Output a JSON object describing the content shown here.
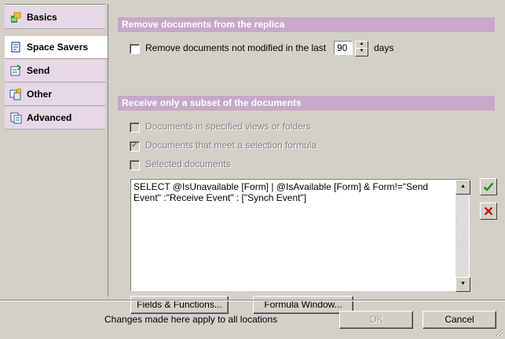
{
  "sidebar": {
    "items": [
      {
        "label": "Basics",
        "icon": "basics-icon"
      },
      {
        "label": "Space Savers",
        "icon": "space-savers-icon",
        "active": true
      },
      {
        "label": "Send",
        "icon": "send-icon"
      },
      {
        "label": "Other",
        "icon": "other-icon"
      },
      {
        "label": "Advanced",
        "icon": "advanced-icon"
      }
    ]
  },
  "remove_section": {
    "title": "Remove documents from the replica",
    "checkbox_label": "Remove documents not modified in the last",
    "days_value": "90",
    "days_suffix": "days"
  },
  "subset_section": {
    "title": "Receive only a subset of the documents",
    "options": [
      {
        "label": "Documents in specified views or folders",
        "checked": false
      },
      {
        "label": "Documents that meet a selection formula",
        "checked": true
      },
      {
        "label": "Selected documents",
        "checked": false
      }
    ],
    "formula": "SELECT @IsUnavailable [Form] | @IsAvailable [Form] & Form!=\"Send\nEvent\" :\"Receive Event\" : [\"Synch Event\"]",
    "fields_button": "Fields & Functions...",
    "formula_window_button": "Formula Window..."
  },
  "footer": {
    "note": "Changes made here apply to all locations",
    "ok_label": "OK",
    "cancel_label": "Cancel"
  },
  "colors": {
    "section_header": "#c8a8c8",
    "sidebar_item": "#e6d8e6",
    "accept": "#1f8a1f",
    "reject": "#cc0000"
  }
}
